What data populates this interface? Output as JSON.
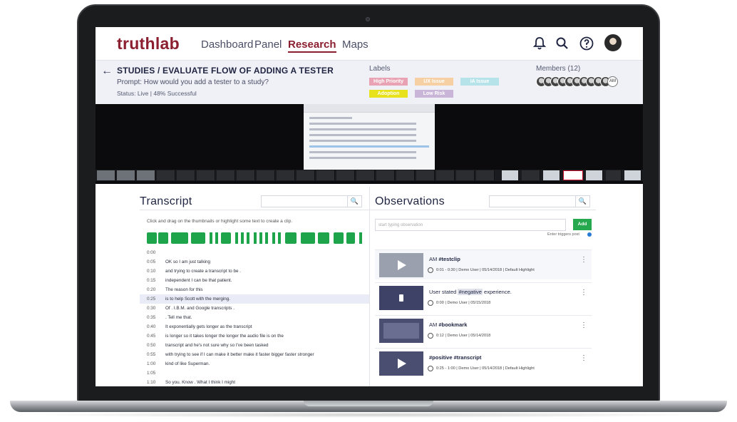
{
  "nav": {
    "logo": "truthlab",
    "links": [
      "Dashboard",
      "Panel",
      "Research",
      "Maps"
    ],
    "active": "Research"
  },
  "study": {
    "title": "STUDIES / EVALUATE FLOW OF ADDING A TESTER",
    "prompt": "Prompt: How would you add a tester to a study?",
    "status": "Status: Live | 48% Successful",
    "labels_title": "Labels",
    "labels": [
      {
        "text": "High Priority",
        "color": "#e8a2b4"
      },
      {
        "text": "UX Issue",
        "color": "#f6cfa3"
      },
      {
        "text": "IA Issue",
        "color": "#b6e3ea"
      },
      {
        "text": "Adoption",
        "color": "#e8e21c"
      },
      {
        "text": "Low Risk",
        "color": "#c9b5d8"
      }
    ],
    "members_title": "Members (12)",
    "member_initials": "AM"
  },
  "transcript": {
    "title": "Transcript",
    "hint": "Click and drag on the thumbnails or highlight some text to create a clip.",
    "rows": [
      {
        "time": "0:00",
        "text": ""
      },
      {
        "time": "0:05",
        "text": "OK so I am just talking"
      },
      {
        "time": "0:10",
        "text": "and trying to create a transcript to be ."
      },
      {
        "time": "0:15",
        "text": "independent I can be that patient."
      },
      {
        "time": "0:20",
        "text": "The reason for this"
      },
      {
        "time": "0:25",
        "text": "is to help Scott with the merging."
      },
      {
        "time": "0:30",
        "text": "Of  . I.B.M. and Google transcripts  ."
      },
      {
        "time": "0:35",
        "text": ". Tell me that."
      },
      {
        "time": "0:40",
        "text": "It exponentially gets longer as the transcript"
      },
      {
        "time": "0:45",
        "text": "is longer so it takes longer the longer the audio file is on the"
      },
      {
        "time": "0:50",
        "text": "transcript and he's not sure why so I've been tasked"
      },
      {
        "time": "0:55",
        "text": "with trying to see if I can make it better make it faster bigger faster stronger"
      },
      {
        "time": "1:00",
        "text": "kind of like Superman."
      },
      {
        "time": "1:05",
        "text": ""
      },
      {
        "time": "1:10",
        "text": "So you. Know . What I think I might"
      }
    ],
    "highlighted_row": 5
  },
  "observations": {
    "title": "Observations",
    "input_placeholder": "start typing observation",
    "add_label": "Add",
    "enter_hint": "Enter triggers post",
    "cards": [
      {
        "user": "AM",
        "tag": "#testclip",
        "text": "",
        "meta": "0:01 - 0:30 | Demo User | 05/14/2018 | Default Highlight",
        "thumb": "gray"
      },
      {
        "user": "",
        "tag": "",
        "text_before": "User stated ",
        "highlight": "#negative",
        "text_after": " experience.",
        "meta": "0:00 | Demo User | 05/15/2018",
        "thumb": "navy"
      },
      {
        "user": "AM",
        "tag": "#bookmark",
        "text": "",
        "meta": "0:12 | Demo User | 05/14/2018",
        "thumb": "navy-screen"
      },
      {
        "user": "",
        "tag": "#positive #transcript",
        "text": "",
        "meta": "0:25 - 1:00 | Demo User | 05/14/2018 | Default Highlight",
        "thumb": "navy-play"
      }
    ]
  }
}
